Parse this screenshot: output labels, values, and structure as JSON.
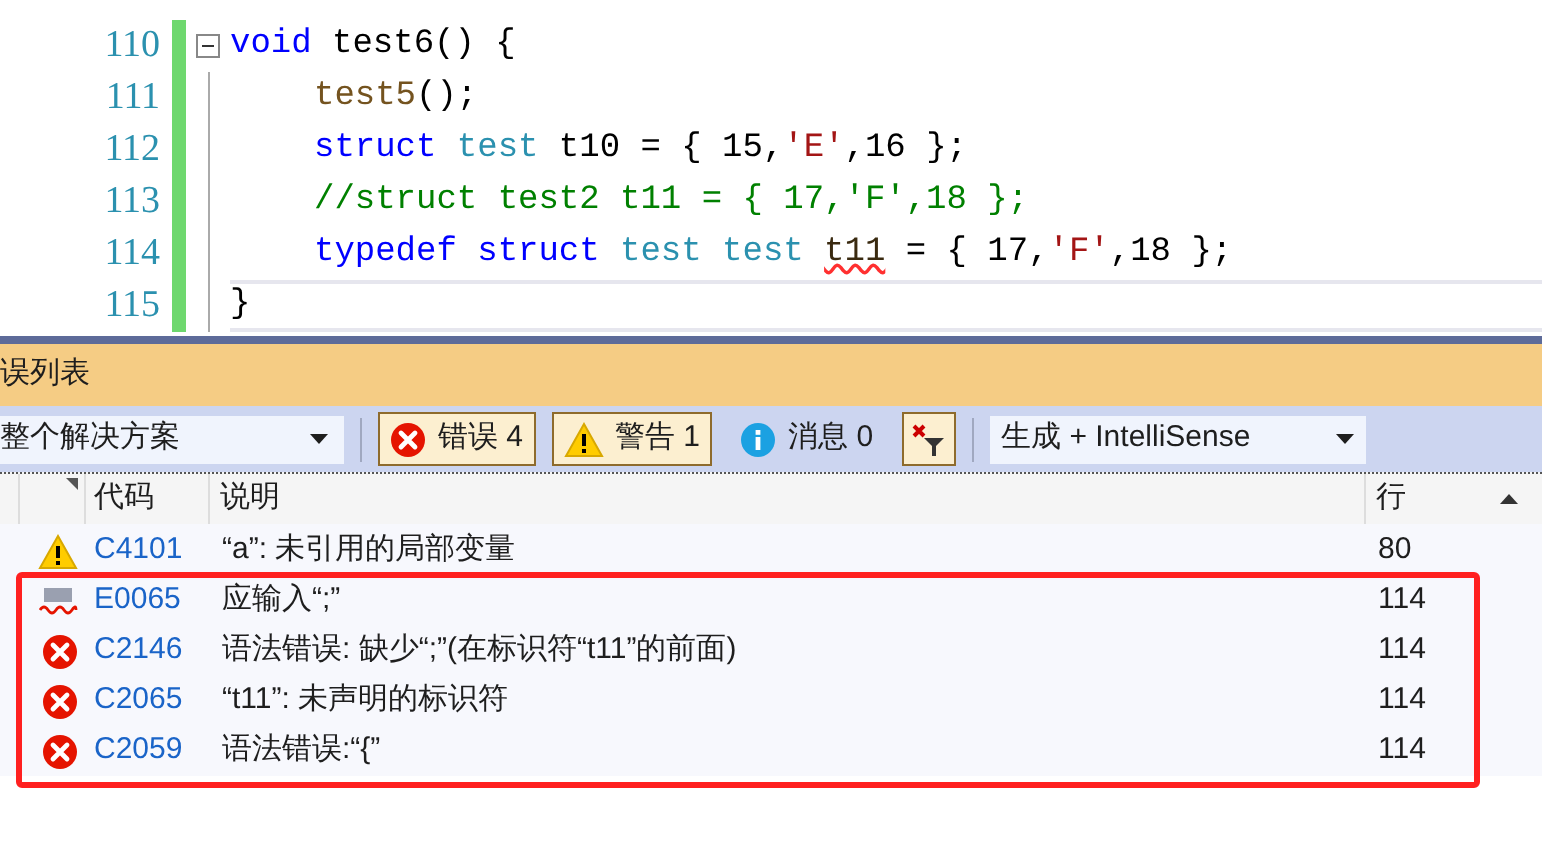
{
  "editor": {
    "lines": [
      {
        "number": "110",
        "fold": true,
        "indented": false,
        "current": false,
        "tokens": [
          {
            "kind": "keyword",
            "text": "void"
          },
          {
            "kind": "plain",
            "text": " test6() {"
          }
        ]
      },
      {
        "number": "111",
        "fold": false,
        "indented": true,
        "current": false,
        "tokens": [
          {
            "kind": "func",
            "text": "test5"
          },
          {
            "kind": "plain",
            "text": "();"
          }
        ]
      },
      {
        "number": "112",
        "fold": false,
        "indented": true,
        "current": false,
        "tokens": [
          {
            "kind": "keyword",
            "text": "struct"
          },
          {
            "kind": "type",
            "text": " test"
          },
          {
            "kind": "plain",
            "text": " t10 = { 15,"
          },
          {
            "kind": "string",
            "text": "'E'"
          },
          {
            "kind": "plain",
            "text": ",16 };"
          }
        ]
      },
      {
        "number": "113",
        "fold": false,
        "indented": true,
        "current": false,
        "tokens": [
          {
            "kind": "comment",
            "text": "//struct test2 t11 = { 17,'F',18 };"
          }
        ]
      },
      {
        "number": "114",
        "fold": false,
        "indented": true,
        "current": false,
        "tokens": [
          {
            "kind": "keyword",
            "text": "typedef struct"
          },
          {
            "kind": "type",
            "text": " test test "
          },
          {
            "kind": "error",
            "text": "t11"
          },
          {
            "kind": "plain",
            "text": " = { 17,"
          },
          {
            "kind": "string",
            "text": "'F'"
          },
          {
            "kind": "plain",
            "text": ",18 };"
          }
        ]
      },
      {
        "number": "115",
        "fold": false,
        "indented": false,
        "current": true,
        "tokens": [
          {
            "kind": "plain",
            "text": "}"
          }
        ]
      }
    ]
  },
  "error_list": {
    "title": "误列表",
    "scope": "整个解决方案",
    "filters": [
      {
        "kind": "error",
        "label": "错误 4",
        "selected": true
      },
      {
        "kind": "warning",
        "label": "警告 1",
        "selected": true
      },
      {
        "kind": "info",
        "label": "消息 0",
        "selected": false
      }
    ],
    "clear_filter": {
      "selected": true
    },
    "source": "生成 + IntelliSense",
    "columns": [
      "代码",
      "说明",
      "行"
    ],
    "rows": [
      {
        "kind": "warning",
        "code": "C4101",
        "description": "“a”: 未引用的局部变量",
        "line": "80",
        "highlighted": false
      },
      {
        "kind": "intellisense",
        "code": "E0065",
        "description": "应输入“;”",
        "line": "114",
        "highlighted": true
      },
      {
        "kind": "error",
        "code": "C2146",
        "description": "语法错误: 缺少“;”(在标识符“t11”的前面)",
        "line": "114",
        "highlighted": true
      },
      {
        "kind": "error",
        "code": "C2065",
        "description": "“t11”: 未声明的标识符",
        "line": "114",
        "highlighted": true
      },
      {
        "kind": "error",
        "code": "C2059",
        "description": "语法错误:“{”",
        "line": "114",
        "highlighted": true
      }
    ]
  }
}
